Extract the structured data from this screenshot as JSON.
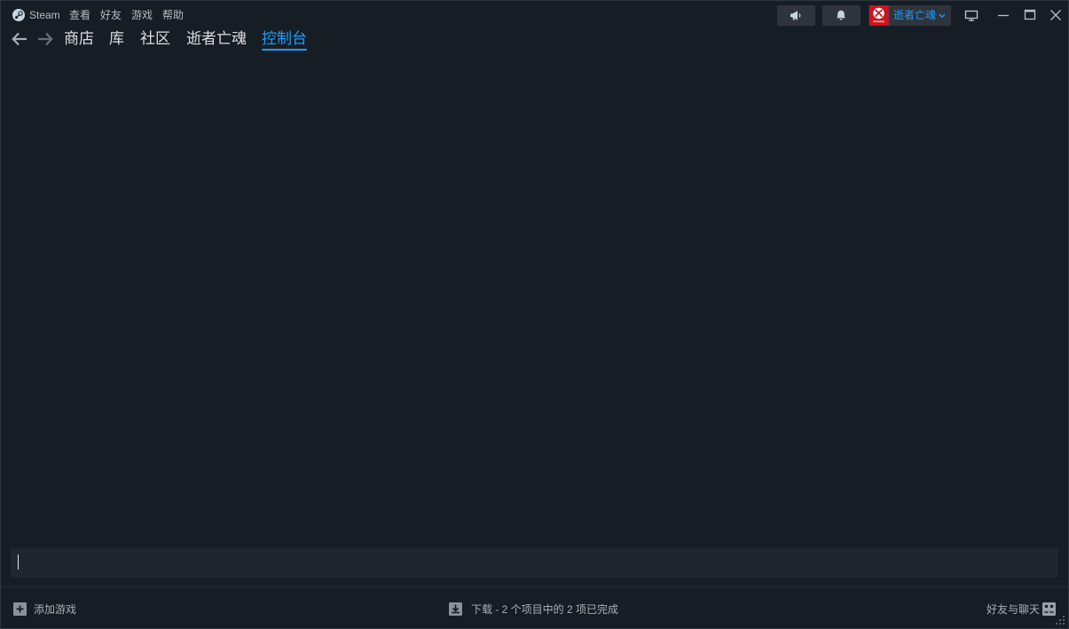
{
  "menu": {
    "app_name": "Steam",
    "items": [
      "查看",
      "好友",
      "游戏",
      "帮助"
    ]
  },
  "header": {
    "user_name": "逝者亡魂"
  },
  "nav": {
    "tabs": [
      {
        "label": "商店",
        "active": false
      },
      {
        "label": "库",
        "active": false
      },
      {
        "label": "社区",
        "active": false
      },
      {
        "label": "逝者亡魂",
        "active": false
      },
      {
        "label": "控制台",
        "active": true
      }
    ]
  },
  "console": {
    "input_value": ""
  },
  "footer": {
    "add_game_label": "添加游戏",
    "download_status": "下载 - 2 个项目中的 2 项已完成",
    "friends_chat_label": "好友与聊天"
  },
  "colors": {
    "background": "#171d25",
    "accent": "#1a9fff",
    "text": "#dcdedf",
    "muted": "#8b929a",
    "button": "#2f343c",
    "avatar": "#d0121b"
  },
  "icons": {
    "logo": "steam-logo-icon",
    "announcements": "megaphone-icon",
    "notifications": "bell-icon",
    "user_menu": "chevron-down-icon",
    "big_picture": "monitor-icon",
    "minimize": "minimize-icon",
    "maximize": "maximize-icon",
    "close": "close-icon",
    "back": "arrow-left-icon",
    "forward": "arrow-right-icon",
    "add_game": "plus-box-icon",
    "downloads": "download-icon",
    "friends": "chat-icon",
    "resize": "resize-grip-icon"
  }
}
